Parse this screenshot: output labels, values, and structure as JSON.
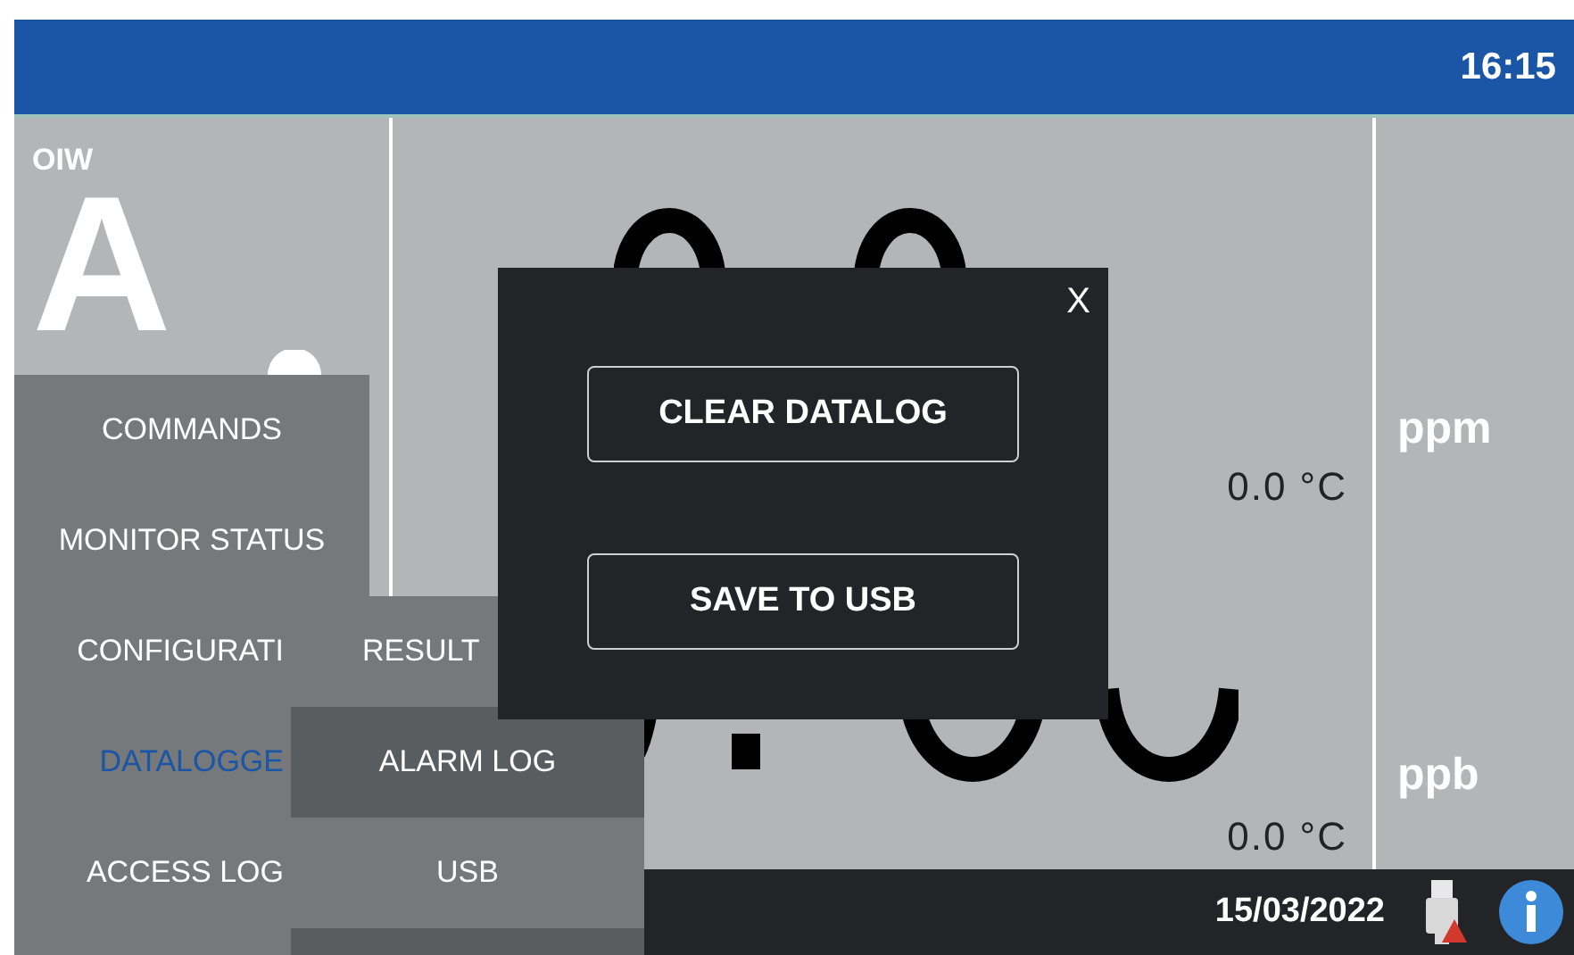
{
  "header": {
    "time": "16:15"
  },
  "measurement": {
    "parameter": "OIW",
    "mode": "A",
    "channels": [
      {
        "unit": "ppm",
        "temperature": "0.0 °C"
      },
      {
        "unit": "ppb",
        "temperature": "0.0 °C"
      }
    ]
  },
  "menu": {
    "items": [
      {
        "label": "COMMANDS",
        "selected": false
      },
      {
        "label": "MONITOR STATUS",
        "selected": false
      },
      {
        "label": "CONFIGURATI",
        "selected": false
      },
      {
        "label": "DATALOGGE",
        "selected": true
      },
      {
        "label": "ACCESS LOG",
        "selected": false
      }
    ],
    "submenu": [
      {
        "label": "RESULT"
      },
      {
        "label": "ALARM LOG"
      },
      {
        "label": "USB"
      }
    ]
  },
  "dialog": {
    "close": "X",
    "buttons": [
      "CLEAR DATALOG",
      "SAVE TO USB"
    ]
  },
  "footer": {
    "date": "15/03/2022"
  }
}
